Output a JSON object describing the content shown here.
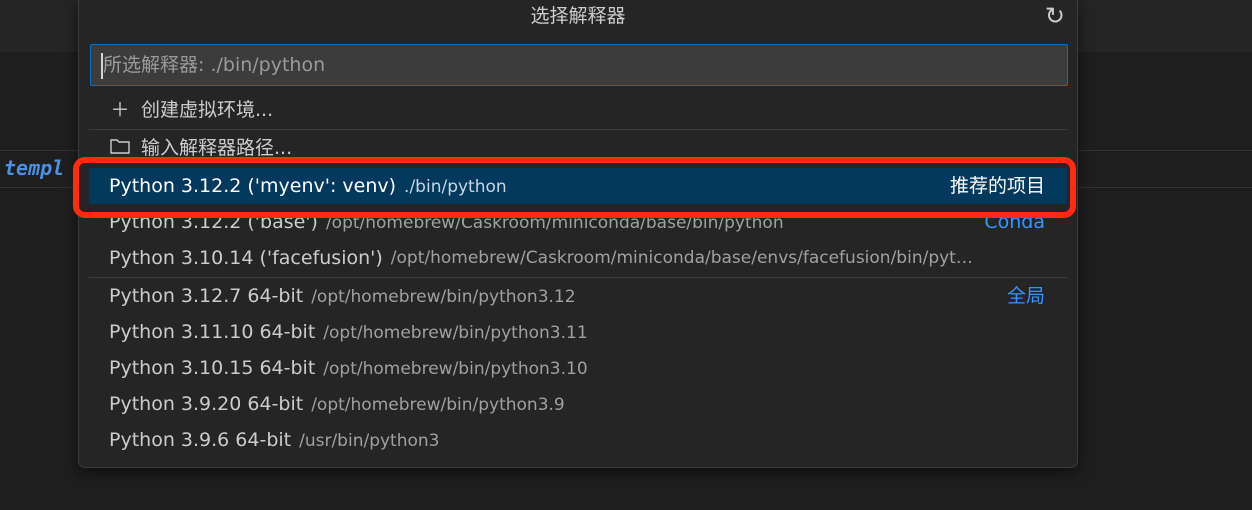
{
  "editor": {
    "code_fragment": "templ"
  },
  "quick_pick": {
    "title": "选择解释器",
    "refresh_icon": "refresh-icon",
    "input": {
      "placeholder": "所选解释器: ./bin/python",
      "value": ""
    },
    "actions": [
      {
        "icon": "plus-icon",
        "label": "创建虚拟环境..."
      },
      {
        "icon": "folder-icon",
        "label": "输入解释器路径..."
      }
    ],
    "selected": {
      "name": "Python 3.12.2 ('myenv': venv)",
      "path": "./bin/python",
      "tag": "推荐的项目"
    },
    "conda": [
      {
        "name": "Python 3.12.2 ('base')",
        "path": "/opt/homebrew/Caskroom/miniconda/base/bin/python",
        "tag": "Conda"
      },
      {
        "name": "Python 3.10.14 ('facefusion')",
        "path": "/opt/homebrew/Caskroom/miniconda/base/envs/facefusion/bin/pyt…",
        "tag": ""
      }
    ],
    "global": [
      {
        "name": "Python 3.12.7 64-bit",
        "path": "/opt/homebrew/bin/python3.12",
        "tag": "全局"
      },
      {
        "name": "Python 3.11.10 64-bit",
        "path": "/opt/homebrew/bin/python3.11",
        "tag": ""
      },
      {
        "name": "Python 3.10.15 64-bit",
        "path": "/opt/homebrew/bin/python3.10",
        "tag": ""
      },
      {
        "name": "Python 3.9.20 64-bit",
        "path": "/opt/homebrew/bin/python3.9",
        "tag": ""
      },
      {
        "name": "Python 3.9.6 64-bit",
        "path": "/usr/bin/python3",
        "tag": ""
      }
    ]
  },
  "colors": {
    "accent": "#3794ff",
    "selection_bg": "#04395e",
    "highlight_border": "#ff2a10",
    "panel_bg": "#252526"
  }
}
